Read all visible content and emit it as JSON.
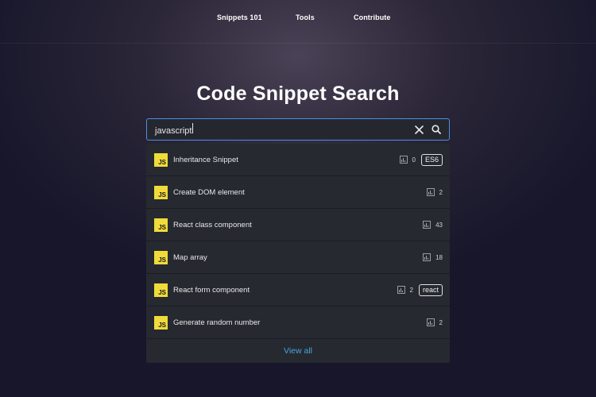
{
  "nav": {
    "items": [
      "Snippets 101",
      "Tools",
      "Contribute"
    ]
  },
  "page": {
    "title": "Code Snippet Search"
  },
  "search": {
    "value": "javascript",
    "placeholder": ""
  },
  "results": [
    {
      "badge": "JS",
      "title": "Inheritance Snippet",
      "count": "0",
      "tag": "ES6"
    },
    {
      "badge": "JS",
      "title": "Create DOM element",
      "count": "2",
      "tag": ""
    },
    {
      "badge": "JS",
      "title": "React class component",
      "count": "43",
      "tag": ""
    },
    {
      "badge": "JS",
      "title": "Map array",
      "count": "18",
      "tag": ""
    },
    {
      "badge": "JS",
      "title": "React form component",
      "count": "2",
      "tag": "react"
    },
    {
      "badge": "JS",
      "title": "Generate random number",
      "count": "2",
      "tag": ""
    }
  ],
  "view_all_label": "View all",
  "colors": {
    "accent": "#4a90e2",
    "link": "#4aa3df",
    "js_badge": "#f0db3a"
  }
}
